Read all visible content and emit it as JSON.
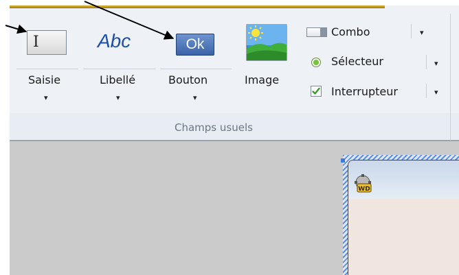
{
  "ribbon": {
    "group_title": "Champs usuels",
    "buttons": [
      {
        "id": "saisie",
        "label": "Saisie"
      },
      {
        "id": "libelle",
        "label": "Libellé"
      },
      {
        "id": "bouton",
        "label": "Bouton"
      },
      {
        "id": "image",
        "label": "Image"
      }
    ],
    "small_items": [
      {
        "id": "combo",
        "label": "Combo"
      },
      {
        "id": "selecteur",
        "label": "Sélecteur"
      },
      {
        "id": "interrupteur",
        "label": "Interrupteur"
      }
    ],
    "abc_text": "Abc",
    "ok_text": "Ok",
    "dropdown_glyph": "▾"
  },
  "frame": {
    "icon_text": "WD"
  },
  "colors": {
    "ribbon_bg": "#eef2f7",
    "editor_bg": "#cbcbcb",
    "accent_blue": "#3b64a8",
    "abc_blue": "#1f4fa3",
    "gold_line": "#c9a227"
  }
}
